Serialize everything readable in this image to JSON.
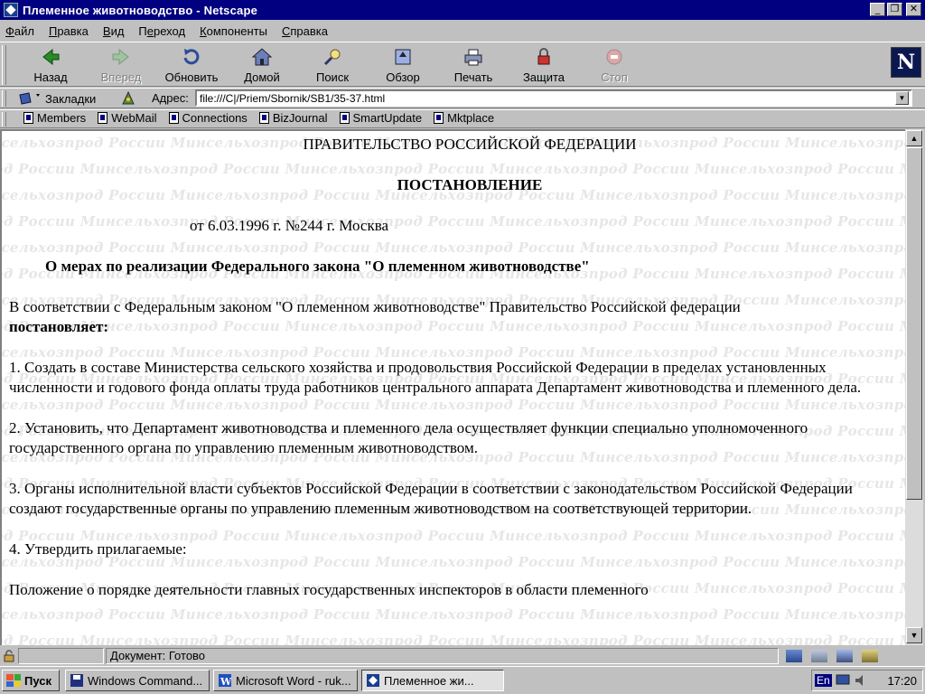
{
  "window": {
    "title": "Племенное животноводство - Netscape"
  },
  "menu": [
    {
      "label": "Файл",
      "u": "Ф",
      "rest": "айл"
    },
    {
      "label": "Правка",
      "u": "П",
      "rest": "равка"
    },
    {
      "label": "Вид",
      "u": "В",
      "rest": "ид"
    },
    {
      "label": "Переход",
      "u": "е",
      "pre": "П",
      "rest": "реход"
    },
    {
      "label": "Компоненты",
      "u": "К",
      "rest": "омпоненты"
    },
    {
      "label": "Справка",
      "u": "С",
      "rest": "правка"
    }
  ],
  "toolbar": {
    "back": "Назад",
    "forward": "Вперед",
    "reload": "Обновить",
    "home": "Домой",
    "search": "Поиск",
    "guide": "Обзор",
    "print": "Печать",
    "security": "Защита",
    "stop": "Стоп"
  },
  "location": {
    "bookmarks": "Закладки",
    "address_label": "Адрес:",
    "url": "file:///C|/Priem/Sbornik/SB1/35-37.html"
  },
  "personal": [
    "Members",
    "WebMail",
    "Connections",
    "BizJournal",
    "SmartUpdate",
    "Mktplace"
  ],
  "document": {
    "authority": "ПРАВИТЕЛЬСТВО РОССИЙСКОЙ ФЕДЕРАЦИИ",
    "doc_type": "ПОСТАНОВЛЕНИЕ",
    "date_line": "от 6.03.1996 г. №244 г. Москва",
    "subject": "О мерах по реализации Федерального закона \"О племенном животноводстве\"",
    "preamble": "В соответствии с Федеральным законом \"О племенном животноводстве\" Правительство Российской федерации",
    "preamble_bold": "постановляет:",
    "p1": "1. Создать в составе Министерства сельского хозяйства и продовольствия Российской Федерации в пределах установленных численности и годового фонда оплаты труда работников центрального аппарата Департамент животноводства и племенного дела.",
    "p2": "2. Установить, что Департамент животноводства и племенного дела осуществляет функции специально уполномоченного государственного органа по управлению племенным животноводством.",
    "p3": "3. Органы исполнительной власти субъектов Российской Федерации в соответствии с законодательством Российской Федерации создают государственные органы по управлению племенным животноводством на соответствующей территории.",
    "p4": "4. Утвердить прилагаемые:",
    "p5": "Положение о порядке деятельности главных государственных инспекторов в области племенного",
    "watermark": "Минсельхозпрод России"
  },
  "status": {
    "text": "Документ: Готово"
  },
  "taskbar": {
    "start": "Пуск",
    "tasks": [
      "Windows Command...",
      "Microsoft Word - ruk...",
      "Племенное жи..."
    ],
    "lang": "En",
    "clock": "17:20"
  },
  "colors": {
    "titlebar": "#000080",
    "face": "#c0c0c0",
    "page": "#ffffff",
    "watermark": "#e6e6e6"
  }
}
